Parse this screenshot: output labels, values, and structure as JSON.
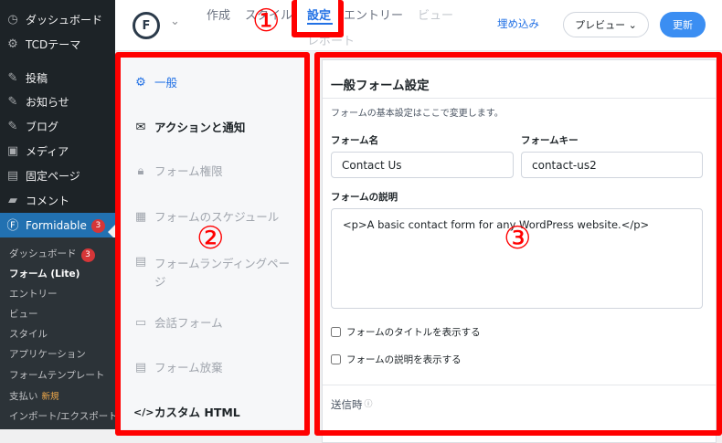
{
  "wp_menu": {
    "items": [
      {
        "label": "ダッシュボード",
        "icon": "dashboard-icon",
        "glyph": "◷"
      },
      {
        "label": "TCDテーマ",
        "icon": "gear-icon",
        "glyph": "⚙"
      },
      {
        "label": "投稿",
        "icon": "pin-icon",
        "glyph": "✎"
      },
      {
        "label": "お知らせ",
        "icon": "pin-icon",
        "glyph": "✎"
      },
      {
        "label": "ブログ",
        "icon": "pin-icon",
        "glyph": "✎"
      },
      {
        "label": "メディア",
        "icon": "media-icon",
        "glyph": "▣"
      },
      {
        "label": "固定ページ",
        "icon": "page-icon",
        "glyph": "▤"
      },
      {
        "label": "コメント",
        "icon": "comment-icon",
        "glyph": "▰"
      }
    ],
    "active": {
      "label": "Formidable",
      "badge": "3",
      "icon": "formidable-icon",
      "glyph": "Ⓕ"
    },
    "submenu": [
      {
        "label": "ダッシュボード",
        "badge": "3"
      },
      {
        "label": "フォーム (Lite)"
      },
      {
        "label": "エントリー"
      },
      {
        "label": "ビュー"
      },
      {
        "label": "スタイル"
      },
      {
        "label": "アプリケーション"
      },
      {
        "label": "フォームテンプレート"
      },
      {
        "label": "支払い",
        "new": "新規"
      },
      {
        "label": "インポート/エクスポート"
      }
    ]
  },
  "topbar": {
    "tabs": [
      "作成",
      "スタイル",
      "設定",
      "エントリー",
      "ビュー",
      "レポート"
    ],
    "embed": "埋め込み",
    "preview": "プレビュー ⌄",
    "update": "更新"
  },
  "settings_nav": [
    {
      "label": "一般",
      "icon": "gear-icon",
      "glyph": "⚙"
    },
    {
      "label": "アクションと通知",
      "icon": "inbox-icon",
      "glyph": "✉"
    },
    {
      "label": "フォーム権限",
      "icon": "lock-icon",
      "glyph": "🔒︎"
    },
    {
      "label": "フォームのスケジュール",
      "icon": "calendar-icon",
      "glyph": "▦"
    },
    {
      "label": "フォームランディングページ",
      "icon": "document-icon",
      "glyph": "▤"
    },
    {
      "label": "会話フォーム",
      "icon": "chat-icon",
      "glyph": "▭"
    },
    {
      "label": "フォーム放棄",
      "icon": "document-x-icon",
      "glyph": "▤"
    },
    {
      "label": "カスタム HTML",
      "icon": "code-icon",
      "glyph": "</>"
    }
  ],
  "general": {
    "title": "一般フォーム設定",
    "description": "フォームの基本設定はここで変更します。",
    "name_label": "フォーム名",
    "name_value": "Contact Us",
    "key_label": "フォームキー",
    "key_value": "contact-us2",
    "desc_label": "フォームの説明",
    "desc_value": "<p>A basic contact form for any WordPress website.</p>",
    "show_title": "フォームのタイトルを表示する",
    "show_desc": "フォームの説明を表示する",
    "on_submit": "送信時",
    "info_glyph": "ⓘ"
  },
  "annotations": {
    "one": "①",
    "two": "②",
    "three": "③",
    "color": "#ff0000"
  }
}
